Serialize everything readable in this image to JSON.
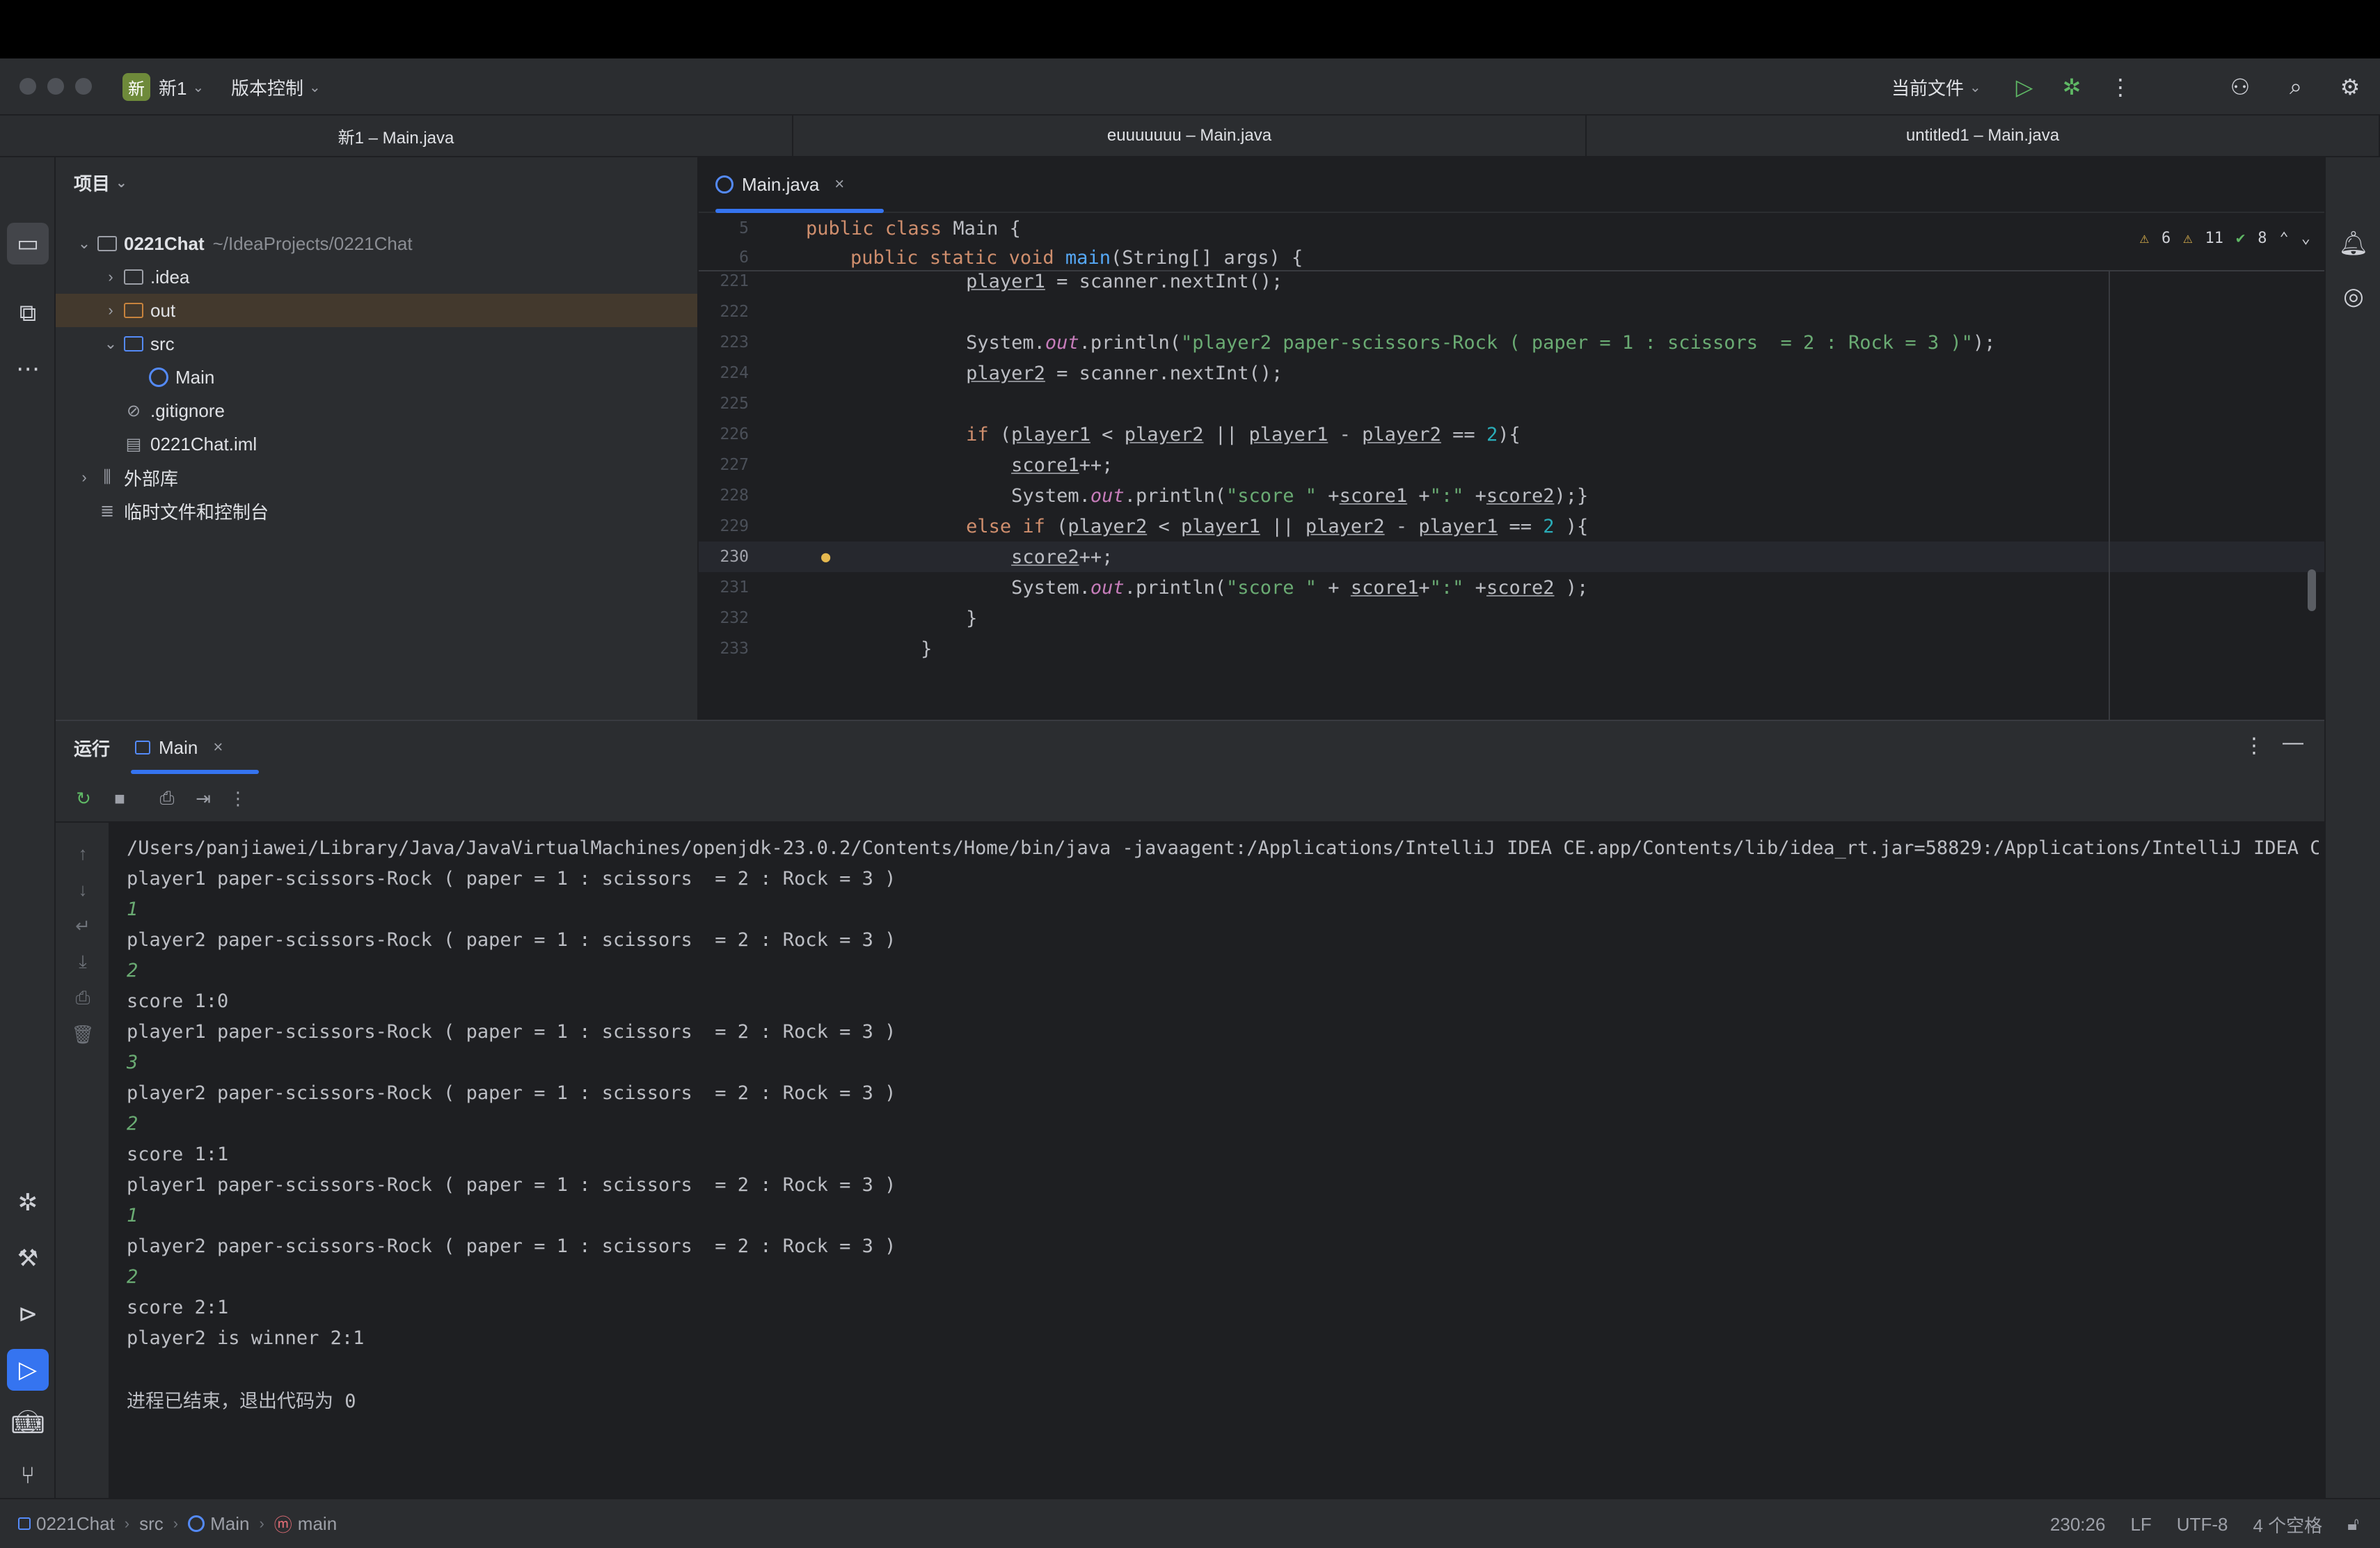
{
  "titlebar": {
    "project_badge": "新",
    "project_name": "新1",
    "vcs_label": "版本控制",
    "run_config": "当前文件"
  },
  "window_tabs": [
    "新1 – Main.java",
    "euuuuuuu – Main.java",
    "untitled1 – Main.java"
  ],
  "project_panel": {
    "title": "项目",
    "tree": [
      {
        "label": "0221Chat",
        "path": "~/IdeaProjects/0221Chat"
      },
      {
        "label": ".idea"
      },
      {
        "label": "out"
      },
      {
        "label": "src"
      },
      {
        "label": "Main"
      },
      {
        "label": ".gitignore"
      },
      {
        "label": "0221Chat.iml"
      },
      {
        "label": "外部库"
      },
      {
        "label": "临时文件和控制台"
      }
    ]
  },
  "editor": {
    "tab_label": "Main.java",
    "indicators": {
      "warnings_a": "6",
      "warnings_b": "11",
      "ok": "8"
    },
    "sticky": [
      {
        "num": "5",
        "text": "public class Main {"
      },
      {
        "num": "6",
        "text": "    public static void main(String[] args) {"
      }
    ],
    "lines": [
      {
        "num": "221",
        "text": "                player1 = scanner.nextInt();"
      },
      {
        "num": "222",
        "text": ""
      },
      {
        "num": "223",
        "text": "                System.out.println(\"player2 paper-scissors-Rock ( paper = 1 : scissors  = 2 : Rock = 3 )\");"
      },
      {
        "num": "224",
        "text": "                player2 = scanner.nextInt();"
      },
      {
        "num": "225",
        "text": ""
      },
      {
        "num": "226",
        "text": "                if (player1 < player2 || player1 - player2 == 2){"
      },
      {
        "num": "227",
        "text": "                    score1++;"
      },
      {
        "num": "228",
        "text": "                    System.out.println(\"score \" +score1 +\":\" +score2);}"
      },
      {
        "num": "229",
        "text": "                else if (player2 < player1 || player2 - player1 == 2 ){"
      },
      {
        "num": "230",
        "text": "                    score2++;"
      },
      {
        "num": "231",
        "text": "                    System.out.println(\"score \" + score1+\":\" +score2 );"
      },
      {
        "num": "232",
        "text": "                }"
      },
      {
        "num": "233",
        "text": "            }"
      }
    ]
  },
  "run_panel": {
    "label": "运行",
    "tab_label": "Main",
    "console": [
      {
        "text": "/Users/panjiawei/Library/Java/JavaVirtualMachines/openjdk-23.0.2/Contents/Home/bin/java -javaagent:/Applications/IntelliJ IDEA CE.app/Contents/lib/idea_rt.jar=58829:/Applications/IntelliJ IDEA CE.app/Con",
        "input": false
      },
      {
        "text": "player1 paper-scissors-Rock ( paper = 1 : scissors  = 2 : Rock = 3 )",
        "input": false
      },
      {
        "text": "1",
        "input": true
      },
      {
        "text": "player2 paper-scissors-Rock ( paper = 1 : scissors  = 2 : Rock = 3 )",
        "input": false
      },
      {
        "text": "2",
        "input": true
      },
      {
        "text": "score 1:0",
        "input": false
      },
      {
        "text": "player1 paper-scissors-Rock ( paper = 1 : scissors  = 2 : Rock = 3 )",
        "input": false
      },
      {
        "text": "3",
        "input": true
      },
      {
        "text": "player2 paper-scissors-Rock ( paper = 1 : scissors  = 2 : Rock = 3 )",
        "input": false
      },
      {
        "text": "2",
        "input": true
      },
      {
        "text": "score 1:1",
        "input": false
      },
      {
        "text": "player1 paper-scissors-Rock ( paper = 1 : scissors  = 2 : Rock = 3 )",
        "input": false
      },
      {
        "text": "1",
        "input": true
      },
      {
        "text": "player2 paper-scissors-Rock ( paper = 1 : scissors  = 2 : Rock = 3 )",
        "input": false
      },
      {
        "text": "2",
        "input": true
      },
      {
        "text": "score 2:1",
        "input": false
      },
      {
        "text": "player2 is winner 2:1",
        "input": false
      },
      {
        "text": "",
        "input": false
      },
      {
        "text": "进程已结束，退出代码为 0",
        "input": false
      }
    ]
  },
  "statusbar": {
    "breadcrumbs": [
      "0221Chat",
      "src",
      "Main",
      "main"
    ],
    "position": "230:26",
    "line_ending": "LF",
    "encoding": "UTF-8",
    "indent": "4 个空格"
  },
  "colors": {
    "accent": "#3574f0",
    "background": "#1e1f22",
    "panel": "#2b2d30",
    "keyword": "#cf8e6d",
    "string": "#6aab73"
  }
}
